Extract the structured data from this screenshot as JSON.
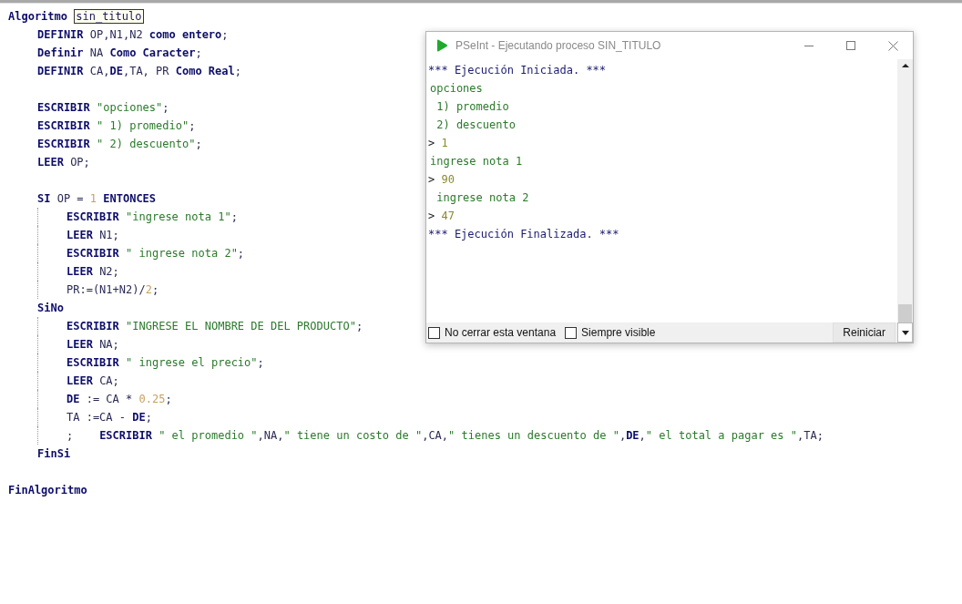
{
  "editor": {
    "lines": [
      {
        "tokens": [
          {
            "kind": "kw",
            "text": "Algoritmo "
          },
          {
            "kind": "match",
            "text": "sin_titulo"
          }
        ],
        "children": [
          {
            "tokens": [
              {
                "kind": "kw",
                "text": "DEFINIR"
              },
              {
                "kind": "txt",
                "text": " OP,N1,N2 "
              },
              {
                "kind": "kw",
                "text": "como entero"
              },
              {
                "kind": "txt",
                "text": ";"
              }
            ]
          },
          {
            "tokens": [
              {
                "kind": "kw",
                "text": "Definir"
              },
              {
                "kind": "txt",
                "text": " NA "
              },
              {
                "kind": "kw",
                "text": "Como Caracter"
              },
              {
                "kind": "txt",
                "text": ";"
              }
            ]
          },
          {
            "tokens": [
              {
                "kind": "kw",
                "text": "DEFINIR"
              },
              {
                "kind": "txt",
                "text": " CA,"
              },
              {
                "kind": "kw",
                "text": "DE"
              },
              {
                "kind": "txt",
                "text": ",TA, PR "
              },
              {
                "kind": "kw",
                "text": "Como Real"
              },
              {
                "kind": "txt",
                "text": ";"
              }
            ]
          },
          {
            "blank_before": true,
            "tokens": [
              {
                "kind": "kw",
                "text": "ESCRIBIR "
              },
              {
                "kind": "str",
                "text": "\"opciones\""
              },
              {
                "kind": "txt",
                "text": ";"
              }
            ]
          },
          {
            "tokens": [
              {
                "kind": "kw",
                "text": "ESCRIBIR "
              },
              {
                "kind": "str",
                "text": "\" 1) promedio\""
              },
              {
                "kind": "txt",
                "text": ";"
              }
            ]
          },
          {
            "tokens": [
              {
                "kind": "kw",
                "text": "ESCRIBIR "
              },
              {
                "kind": "str",
                "text": "\" 2) descuento\""
              },
              {
                "kind": "txt",
                "text": ";"
              }
            ]
          },
          {
            "tokens": [
              {
                "kind": "kw",
                "text": "LEER"
              },
              {
                "kind": "txt",
                "text": " OP;"
              }
            ]
          },
          {
            "blank_before": true,
            "guide": true,
            "tokens": [
              {
                "kind": "kw",
                "text": "SI"
              },
              {
                "kind": "txt",
                "text": " OP = "
              },
              {
                "kind": "num",
                "text": "1"
              },
              {
                "kind": "kw",
                "text": " ENTONCES"
              }
            ],
            "children": [
              {
                "tokens": [
                  {
                    "kind": "kw",
                    "text": "ESCRIBIR "
                  },
                  {
                    "kind": "str",
                    "text": "\"ingrese nota 1\""
                  },
                  {
                    "kind": "txt",
                    "text": ";"
                  }
                ]
              },
              {
                "tokens": [
                  {
                    "kind": "kw",
                    "text": "LEER"
                  },
                  {
                    "kind": "txt",
                    "text": " N1;"
                  }
                ]
              },
              {
                "tokens": [
                  {
                    "kind": "kw",
                    "text": "ESCRIBIR "
                  },
                  {
                    "kind": "str",
                    "text": "\" ingrese nota 2\""
                  },
                  {
                    "kind": "txt",
                    "text": ";"
                  }
                ]
              },
              {
                "tokens": [
                  {
                    "kind": "kw",
                    "text": "LEER"
                  },
                  {
                    "kind": "txt",
                    "text": " N2;"
                  }
                ]
              },
              {
                "tokens": [
                  {
                    "kind": "txt",
                    "text": "PR:=(N1+N2)/"
                  },
                  {
                    "kind": "num",
                    "text": "2"
                  },
                  {
                    "kind": "txt",
                    "text": ";"
                  }
                ]
              }
            ]
          },
          {
            "guide": true,
            "tokens": [
              {
                "kind": "kw",
                "text": "SiNo"
              }
            ],
            "children": [
              {
                "tokens": [
                  {
                    "kind": "kw",
                    "text": "ESCRIBIR "
                  },
                  {
                    "kind": "str",
                    "text": "\"INGRESE EL NOMBRE DE DEL PRODUCTO\""
                  },
                  {
                    "kind": "txt",
                    "text": ";"
                  }
                ]
              },
              {
                "tokens": [
                  {
                    "kind": "kw",
                    "text": "LEER"
                  },
                  {
                    "kind": "txt",
                    "text": " NA;"
                  }
                ]
              },
              {
                "tokens": [
                  {
                    "kind": "kw",
                    "text": "ESCRIBIR "
                  },
                  {
                    "kind": "str",
                    "text": "\" ingrese el precio\""
                  },
                  {
                    "kind": "txt",
                    "text": ";"
                  }
                ]
              },
              {
                "tokens": [
                  {
                    "kind": "kw",
                    "text": "LEER"
                  },
                  {
                    "kind": "txt",
                    "text": " CA;"
                  }
                ]
              },
              {
                "tokens": [
                  {
                    "kind": "kw",
                    "text": "DE"
                  },
                  {
                    "kind": "txt",
                    "text": " := CA * "
                  },
                  {
                    "kind": "num",
                    "text": "0.25"
                  },
                  {
                    "kind": "txt",
                    "text": ";"
                  }
                ]
              },
              {
                "tokens": [
                  {
                    "kind": "txt",
                    "text": "TA :=CA - "
                  },
                  {
                    "kind": "kw",
                    "text": "DE"
                  },
                  {
                    "kind": "txt",
                    "text": ";"
                  }
                ]
              },
              {
                "tokens": [
                  {
                    "kind": "txt",
                    "text": ";    "
                  },
                  {
                    "kind": "kw",
                    "text": "ESCRIBIR "
                  },
                  {
                    "kind": "str",
                    "text": "\" el promedio \""
                  },
                  {
                    "kind": "txt",
                    "text": ",NA,"
                  },
                  {
                    "kind": "str",
                    "text": "\" tiene un costo de \""
                  },
                  {
                    "kind": "txt",
                    "text": ",CA,"
                  },
                  {
                    "kind": "str",
                    "text": "\" tienes un descuento de \""
                  },
                  {
                    "kind": "txt",
                    "text": ","
                  },
                  {
                    "kind": "kw",
                    "text": "DE"
                  },
                  {
                    "kind": "txt",
                    "text": ","
                  },
                  {
                    "kind": "str",
                    "text": "\" el total a pagar es \""
                  },
                  {
                    "kind": "txt",
                    "text": ",TA;"
                  }
                ]
              }
            ]
          },
          {
            "tokens": [
              {
                "kind": "kw",
                "text": "FinSi"
              }
            ]
          }
        ]
      },
      {
        "blank_before": true,
        "tokens": [
          {
            "kind": "kw",
            "text": "FinAlgoritmo"
          }
        ]
      }
    ]
  },
  "console": {
    "title": "PSeInt - Ejecutando proceso SIN_TITULO",
    "lines": [
      {
        "tokens": [
          {
            "kind": "info",
            "text": "*** Ejecución Iniciada. ***"
          }
        ]
      },
      {
        "tokens": [
          {
            "kind": "out",
            "text": "opciones"
          }
        ]
      },
      {
        "tokens": [
          {
            "kind": "out",
            "text": " 1) promedio"
          }
        ]
      },
      {
        "tokens": [
          {
            "kind": "out",
            "text": " 2) descuento"
          }
        ]
      },
      {
        "tokens": [
          {
            "kind": "prompt",
            "text": "> "
          },
          {
            "kind": "input",
            "text": "1"
          }
        ]
      },
      {
        "tokens": [
          {
            "kind": "out",
            "text": "ingrese nota 1"
          }
        ]
      },
      {
        "tokens": [
          {
            "kind": "prompt",
            "text": "> "
          },
          {
            "kind": "input",
            "text": "90"
          }
        ]
      },
      {
        "tokens": [
          {
            "kind": "out",
            "text": " ingrese nota 2"
          }
        ]
      },
      {
        "tokens": [
          {
            "kind": "prompt",
            "text": "> "
          },
          {
            "kind": "input",
            "text": "47"
          }
        ]
      },
      {
        "tokens": [
          {
            "kind": "info",
            "text": "*** Ejecución Finalizada. ***"
          }
        ]
      }
    ],
    "options": [
      {
        "label": "No cerrar esta ventana",
        "checked": false
      },
      {
        "label": "Siempre visible",
        "checked": false
      }
    ],
    "button": "Reiniciar"
  }
}
